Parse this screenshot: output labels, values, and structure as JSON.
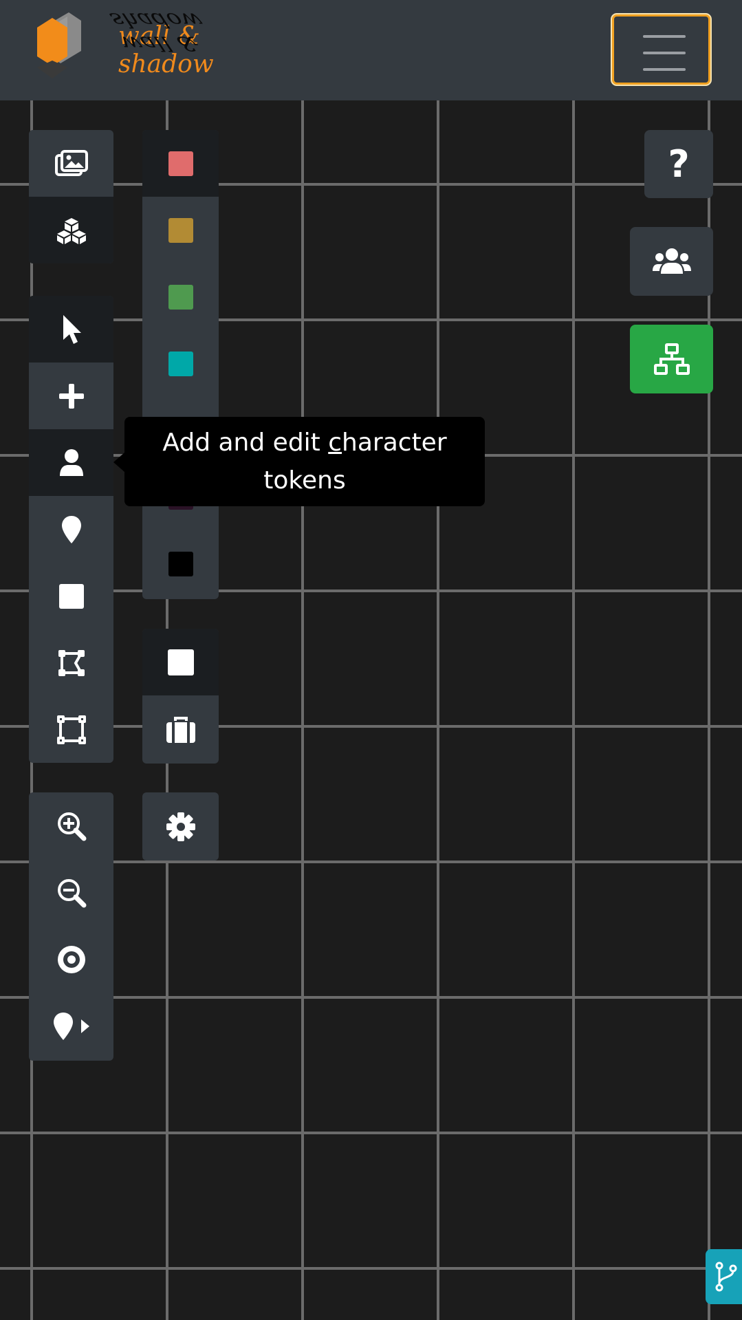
{
  "app": {
    "logo_text": "wall & shadow",
    "logo_reflection": "wall & shadow"
  },
  "header": {
    "menu_icon": "hamburger-icon",
    "accent": "#f0a020"
  },
  "tooltip": {
    "before": "Add and edit ",
    "accel": "c",
    "after": "haracter tokens"
  },
  "tools_top": [
    {
      "name": "images",
      "icon": "images-icon"
    },
    {
      "name": "objects",
      "icon": "cubes-icon",
      "active": true
    }
  ],
  "tools_mode": [
    {
      "name": "select",
      "icon": "pointer-icon",
      "active": true
    },
    {
      "name": "add",
      "icon": "plus-icon"
    },
    {
      "name": "character-tokens",
      "icon": "user-icon",
      "active": true
    },
    {
      "name": "map-marker",
      "icon": "map-marker-icon"
    },
    {
      "name": "square",
      "icon": "square-icon"
    },
    {
      "name": "polygon",
      "icon": "polygon-icon"
    },
    {
      "name": "rectangle",
      "icon": "rectangle-vector-icon"
    }
  ],
  "tools_view": [
    {
      "name": "zoom-in",
      "icon": "zoom-in-icon"
    },
    {
      "name": "zoom-out",
      "icon": "zoom-out-icon"
    },
    {
      "name": "center",
      "icon": "bullseye-icon"
    },
    {
      "name": "marker-next",
      "icon": "map-marker-arrow-icon"
    }
  ],
  "palette": {
    "colors": [
      "#e06c6c",
      "#b28b34",
      "#4f9a4f",
      "#00a8a8",
      "#1d2a4a",
      "#2a1226",
      "#000000"
    ],
    "selected_index": 0
  },
  "extras": [
    {
      "name": "white-square",
      "icon": "white-square-icon",
      "active": true
    },
    {
      "name": "briefcase",
      "icon": "briefcase-icon"
    }
  ],
  "settings": {
    "icon": "gear-icon"
  },
  "right": {
    "help_label": "?",
    "users_icon": "users-icon",
    "network_icon": "network-icon",
    "network_color": "#28a745"
  },
  "git": {
    "icon": "code-branch-icon",
    "color": "#17a2b8"
  }
}
